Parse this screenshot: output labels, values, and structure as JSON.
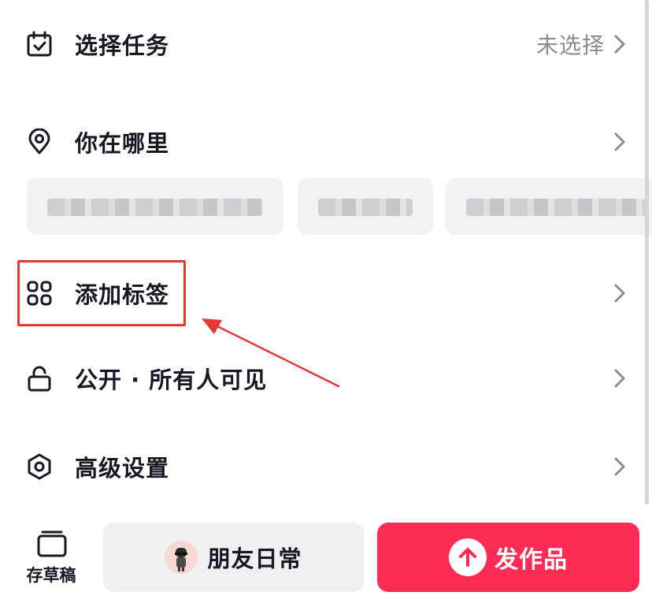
{
  "rows": {
    "task": {
      "label": "选择任务",
      "value": "未选择",
      "icon": "calendar-check-icon"
    },
    "location": {
      "label": "你在哪里",
      "icon": "location-pin-icon"
    },
    "tags": {
      "label": "添加标签",
      "icon": "grid-four-icon"
    },
    "privacy": {
      "label": "公开 · 所有人可见",
      "icon": "unlock-icon"
    },
    "advanced": {
      "label": "高级设置",
      "icon": "hexagon-settings-icon"
    }
  },
  "location_chips": [
    "",
    "",
    ""
  ],
  "bottom": {
    "draft_label": "存草稿",
    "friends_label": "朋友日常",
    "publish_label": "发作品"
  },
  "colors": {
    "accent": "#fe2c55",
    "annotation": "#e53935",
    "text_primary": "#161823",
    "text_secondary": "#8a8b91",
    "chip_bg": "#f2f2f4"
  }
}
